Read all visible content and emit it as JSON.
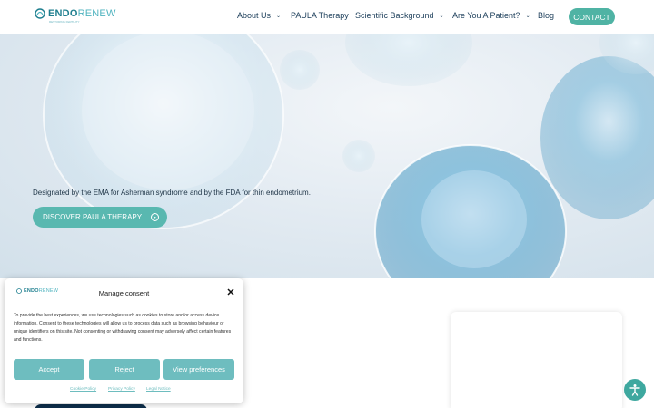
{
  "header": {
    "logo": {
      "text_main": "ENDO",
      "text_accent": "RENEW",
      "tagline": "RESTORING FERTILITY"
    },
    "nav": [
      {
        "label": "About Us",
        "has_dropdown": true
      },
      {
        "label": "PAULA Therapy",
        "has_dropdown": false
      },
      {
        "label": "Scientific Background",
        "has_dropdown": true
      },
      {
        "label": "Are You A Patient?",
        "has_dropdown": true
      },
      {
        "label": "Blog",
        "has_dropdown": false
      }
    ],
    "contact_label": "CONTACT"
  },
  "hero": {
    "text": "Designated by the EMA for Asherman syndrome and by the FDA for thin endometrium.",
    "button_label": "DISCOVER PAULA THERAPY",
    "button_icon": "arrow-circle-icon"
  },
  "consent": {
    "logo": {
      "text_main": "ENDO",
      "text_accent": "RENEW"
    },
    "title": "Manage consent",
    "body": "To provide the best experiences, we use technologies such as cookies to store and/or access device information. Consent to these technologies will allow us to process data such as browsing behaviour or unique identifiers on this site. Not consenting or withdrawing consent may adversely affect certain features and functions.",
    "buttons": {
      "accept": "Accept",
      "reject": "Reject",
      "preferences": "View preferences"
    },
    "links": {
      "cookie_policy": "Cookie Policy",
      "privacy_policy": "Privacy Policy",
      "legal_notice": "Legal Notice"
    }
  },
  "colors": {
    "brand_teal": "#4fb3a4",
    "brand_navy": "#0e2f4c",
    "consent_button": "#6ebdbf"
  }
}
